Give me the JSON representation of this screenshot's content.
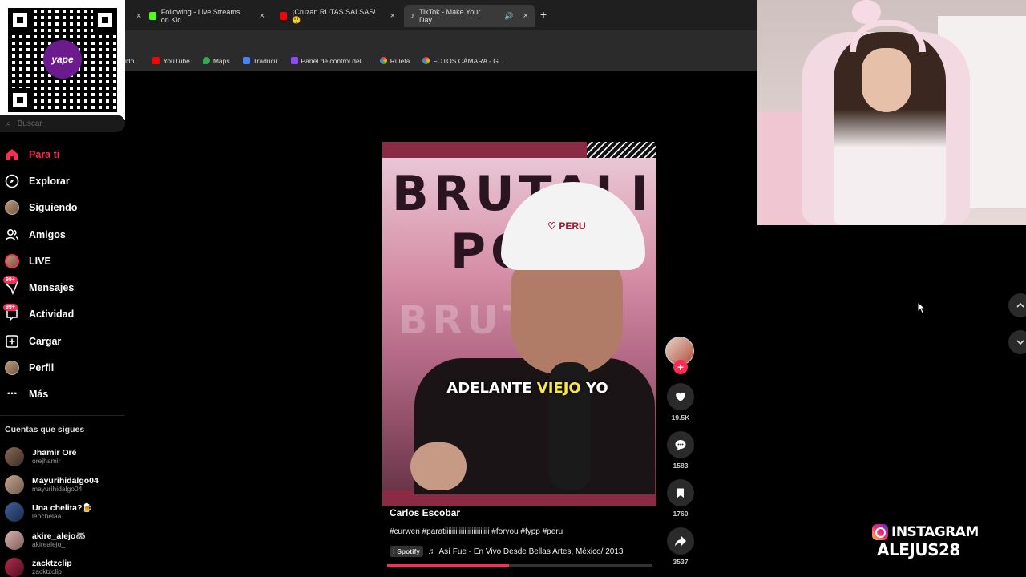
{
  "browser": {
    "tabs": [
      {
        "label": "Following - Live Streams on Kic",
        "color": "#53fc18"
      },
      {
        "label": "¡Cruzan RUTAS SALSAS! 😲",
        "color": "#ff0000"
      },
      {
        "label": "TikTok - Make Your Day",
        "color": "#ffffff",
        "active": true
      }
    ],
    "bookmarks": [
      {
        "label": "ido...",
        "color": "#888888"
      },
      {
        "label": "YouTube",
        "color": "#ff0000"
      },
      {
        "label": "Maps",
        "color": "#34a853"
      },
      {
        "label": "Traducir",
        "color": "#4285f4"
      },
      {
        "label": "Panel de control del...",
        "color": "#9146ff"
      },
      {
        "label": "Ruleta",
        "color": "#fbbc05"
      },
      {
        "label": "FOTOS CÁMARA - G...",
        "color": "#fbbc05"
      }
    ]
  },
  "qr": {
    "logo_text": "yape"
  },
  "sidebar": {
    "search_placeholder": "Buscar",
    "nav": [
      {
        "label": "Para ti",
        "icon": "home-icon",
        "active": true
      },
      {
        "label": "Explorar",
        "icon": "compass-icon"
      },
      {
        "label": "Siguiendo",
        "icon": "avatar"
      },
      {
        "label": "Amigos",
        "icon": "friends-icon"
      },
      {
        "label": "LIVE",
        "icon": "live-avatar"
      },
      {
        "label": "Mensajes",
        "icon": "messages-icon",
        "badge": "99+"
      },
      {
        "label": "Actividad",
        "icon": "activity-icon",
        "badge": "99+"
      },
      {
        "label": "Cargar",
        "icon": "upload-icon"
      },
      {
        "label": "Perfil",
        "icon": "profile-avatar"
      },
      {
        "label": "Más",
        "icon": "more-icon"
      }
    ],
    "following_title": "Cuentas que sigues",
    "following": [
      {
        "name": "Jhamir Oré",
        "user": "orejhamir"
      },
      {
        "name": "Mayurihidalgo04",
        "user": "mayurihidalgo04"
      },
      {
        "name": "Una chelita?🍺",
        "user": "leochelaa"
      },
      {
        "name": "akire_alejo🦝",
        "user": "akirealejo_"
      },
      {
        "name": "zacktzclip",
        "user": "zacktzclip"
      }
    ]
  },
  "video": {
    "text_top": "BRUTALI",
    "text_mid": "PO",
    "text_ghost": "BRUTALI",
    "helmet_text": "PERU",
    "caption_before": "ADELANTE ",
    "caption_highlight": "VIEJO",
    "caption_after": " YO",
    "author": "Carlos Escobar",
    "description": "#curwen #paratiiiiiiiiiiiiiiiiiiiiiiiii #foryou #fypp #peru",
    "music_source": "Spotify",
    "music": "Así Fue - En Vivo Desde Bellas Artes, México/ 2013",
    "progress": 0.46
  },
  "actions": {
    "likes": "19.5K",
    "comments": "1583",
    "saves": "1760",
    "shares": "3537"
  },
  "overlay": {
    "instagram_label": "INSTAGRAM",
    "instagram_user": "ALEJUS28"
  }
}
